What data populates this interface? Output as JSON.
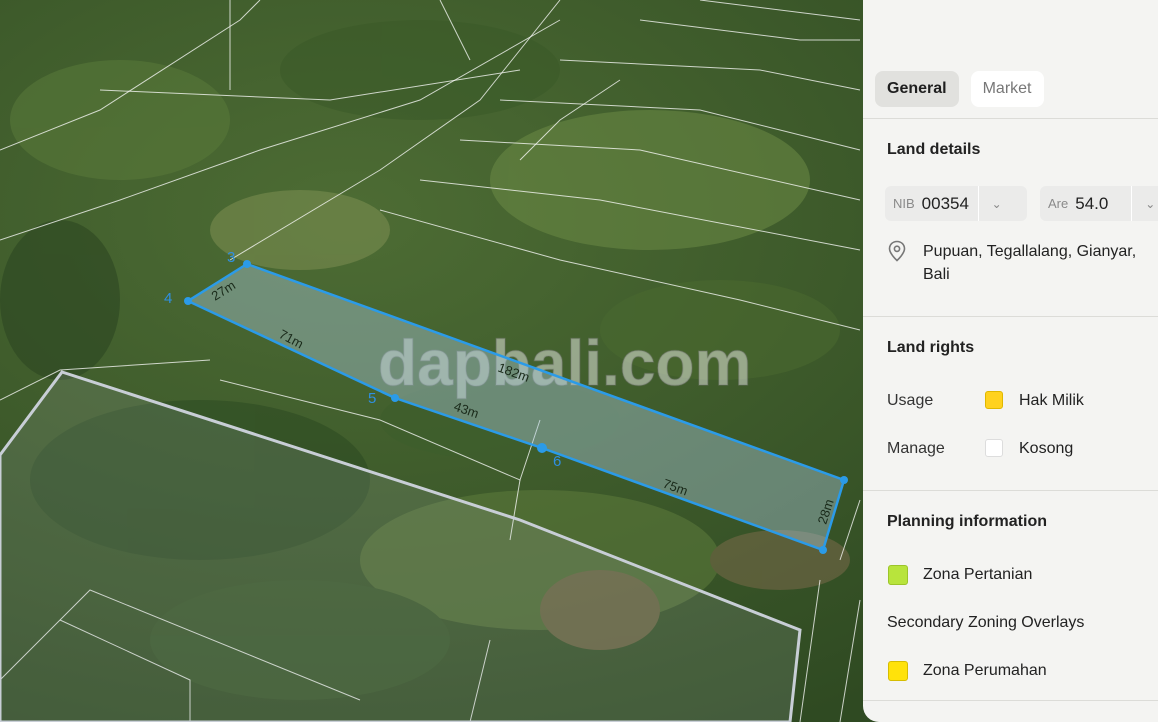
{
  "map": {
    "watermark": "dapbali.com",
    "vertex_labels": [
      "3",
      "4",
      "5",
      "6"
    ],
    "edge_labels": [
      "27m",
      "71m",
      "182m",
      "43m",
      "75m",
      "28m"
    ],
    "plot_color": "#2b9be8"
  },
  "panel": {
    "tabs": [
      {
        "label": "General",
        "active": true
      },
      {
        "label": "Market",
        "active": false
      }
    ],
    "land_details": {
      "title": "Land details",
      "nib_prefix": "NIB",
      "nib_value": "00354",
      "area_prefix": "Are",
      "area_value": "54.0",
      "address": "Pupuan, Tegallalang, Gianyar, Bali"
    },
    "land_rights": {
      "title": "Land rights",
      "usage_label": "Usage",
      "usage_value": "Hak Milik",
      "usage_color": "#ffd21f",
      "manage_label": "Manage",
      "manage_value": "Kosong",
      "manage_color": "#ffffff"
    },
    "planning": {
      "title": "Planning information",
      "zone": "Zona Pertanian",
      "zone_color": "#b8e43c",
      "overlays_title": "Secondary Zoning Overlays",
      "overlay": "Zona Perumahan",
      "overlay_color": "#ffe20a"
    }
  }
}
